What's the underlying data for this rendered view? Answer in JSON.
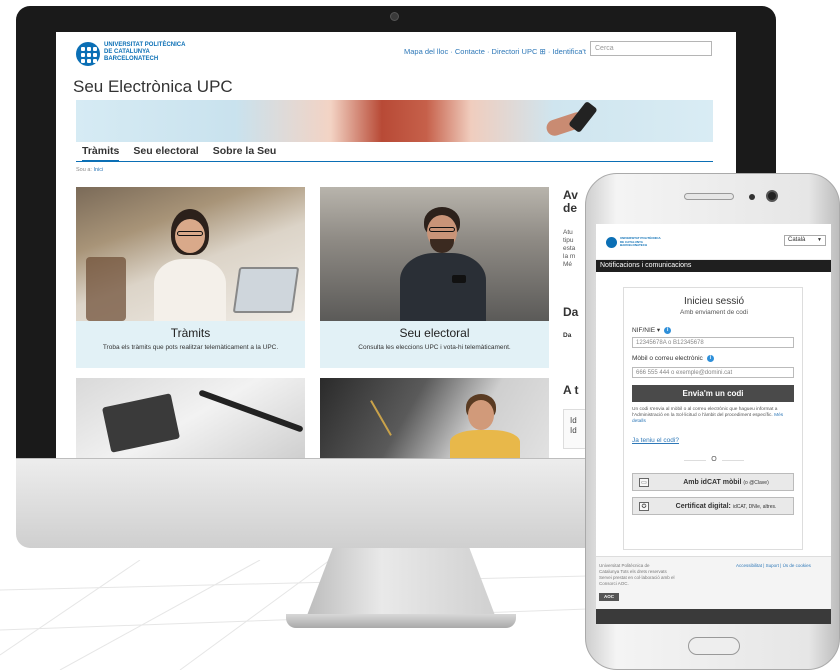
{
  "monitor": {
    "header": {
      "university_name": "UNIVERSITAT POLITÈCNICA\nDE CATALUNYA\nBARCELONATECH",
      "top_links": "Mapa del lloc · Contacte · Directori UPC ⊞ · Identifica't",
      "search_placeholder": "Cerca"
    },
    "site_title": "Seu Electrònica UPC",
    "tabs": [
      {
        "label": "Tràmits"
      },
      {
        "label": "Seu electoral"
      },
      {
        "label": "Sobre la Seu"
      }
    ],
    "breadcrumb": {
      "prefix": "Sou a:",
      "link": "Inici"
    },
    "cards": [
      {
        "title": "Tràmits",
        "desc": "Troba els tràmits que pots realitzar telemàticament a la UPC."
      },
      {
        "title": "Seu electoral",
        "desc": "Consulta les eleccions UPC i vota-hi telemàticament."
      }
    ],
    "sidebar": {
      "heading1": "Av\nde",
      "text1": "Atu\ntipu\nesta\nla m\nMé",
      "heading2": "Da",
      "text2": "Da",
      "heading3": "A t",
      "box_text": "Id\nId"
    }
  },
  "phone": {
    "logo_text": "UNIVERSITAT POLITÈCNICA\nDE CATALUNYA\nBARCELONATECH",
    "language": "Català",
    "bar_title": "Notificacions i comunicacions",
    "login": {
      "title": "Inicieu sessió",
      "subtitle": "Amb enviament de codi",
      "id_label": "NIF/NIE ▾",
      "id_placeholder": "12345678A o B12345678",
      "contact_label": "Mòbil o correu electrònic",
      "contact_placeholder": "666 555 444 o exemple@domini.cat",
      "send_button": "Envia'm un codi",
      "note": "Un codi s'envia al mòbil o al correu electrònic que hagueu informat a l'Administració en la Sol·licitud o l'àmbit del procediment específic.",
      "note_link": "Més detalls",
      "have_code_link": "Ja teniu el codi?",
      "or": "O",
      "idcat_main": "Amb idCAT mòbil",
      "idcat_sub": "(o @Clave)",
      "cert_main": "Certificat digital:",
      "cert_sub": "idCAT, DNIe, altres."
    },
    "footer": {
      "left": "Universitat Politècnica de\nCatalunya Tots els drets reservats\nServei prestat en col·laboració amb el\nConsorci AOC.",
      "right": "Accessibilitat | Suport | Ús de cookies",
      "aoc": "AOC"
    }
  },
  "colors": {
    "brand_blue": "#0b6fb5",
    "link_blue": "#2e78b8",
    "card_bg": "#e2f1f6",
    "button_dark": "#4a4a4a"
  }
}
